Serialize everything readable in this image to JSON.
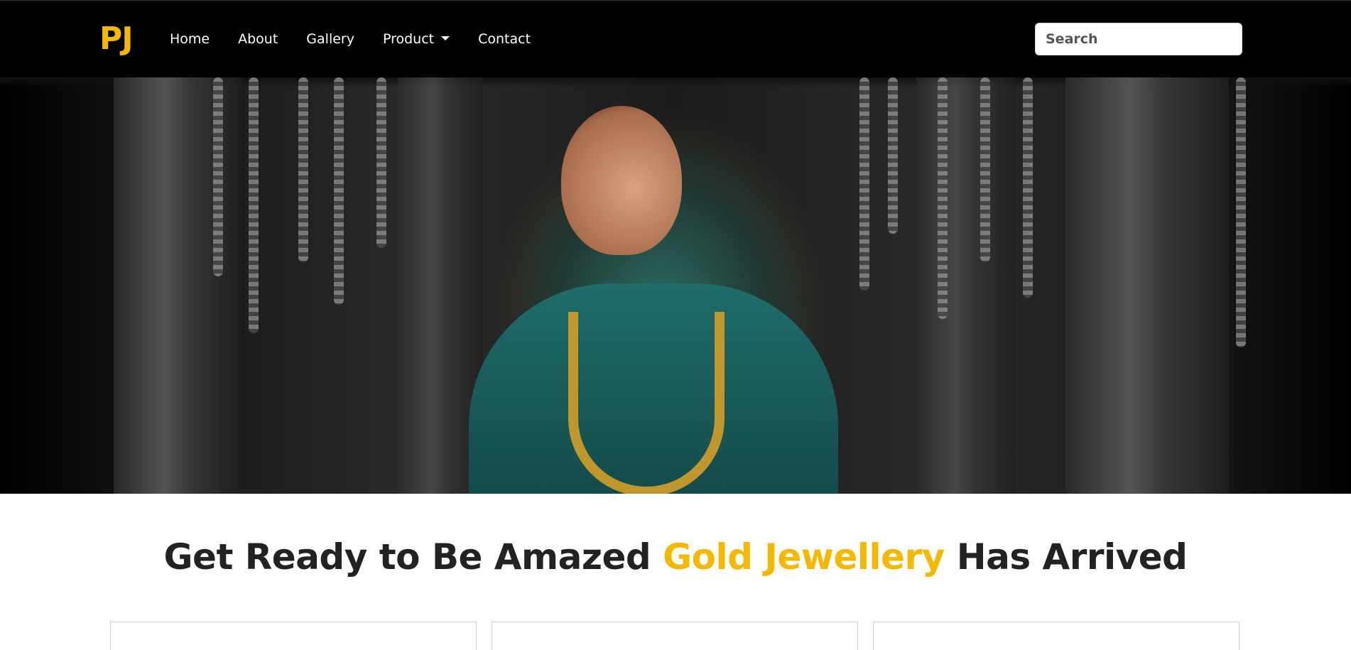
{
  "brand": {
    "text": "PJ",
    "color": "#f5b800"
  },
  "nav": {
    "items": [
      {
        "label": "Home"
      },
      {
        "label": "About"
      },
      {
        "label": "Gallery"
      },
      {
        "label": "Product",
        "has_dropdown": true
      },
      {
        "label": "Contact"
      }
    ]
  },
  "search": {
    "placeholder": "Search",
    "value": ""
  },
  "hero": {
    "image": "bride-gold-jewellery-banner"
  },
  "headline": {
    "part1": "Get Ready to Be Amazed ",
    "highlight": "Gold Jewellery",
    "part2": " Has Arrived",
    "highlight_color": "#f5b800"
  },
  "colors": {
    "navbar_bg": "#000000",
    "accent": "#f5b800",
    "text": "#222222"
  }
}
